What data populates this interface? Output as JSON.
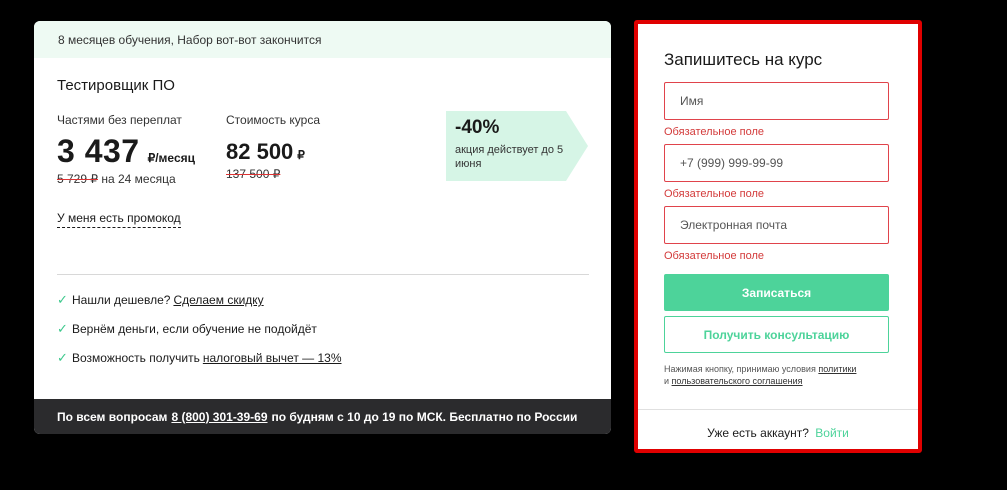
{
  "course": {
    "notice": "8 месяцев обучения, Набор вот-вот закончится",
    "title": "Тестировщик ПО",
    "installment": {
      "label": "Частями без переплат",
      "price": "3 437",
      "unit": "₽/месяц",
      "old_price": "5 729 ₽",
      "term": "на 24 месяца"
    },
    "full": {
      "label": "Стоимость курса",
      "price": "82 500",
      "unit": "₽",
      "old_price": "137 500 ₽"
    },
    "discount": {
      "percent": "-40%",
      "text": "акция действует до 5 июня"
    },
    "promo_link": "У меня есть промокод",
    "benefits": [
      {
        "text": "Нашли дешевле?",
        "link": "Сделаем скидку"
      },
      {
        "text": "Вернём деньги, если обучение не подойдёт",
        "link": ""
      },
      {
        "text": "Возможность получить",
        "link": "налоговый вычет — 13%"
      }
    ],
    "footer": {
      "prefix": "По всем вопросам",
      "phone": "8 (800) 301-39-69",
      "suffix": "по будням с 10 до 19 по МСК. Бесплатно по России"
    }
  },
  "form": {
    "title": "Запишитесь на курс",
    "fields": [
      {
        "placeholder": "Имя",
        "error": "Обязательное поле"
      },
      {
        "placeholder": "+7 (999) 999-99-99",
        "error": "Обязательное поле"
      },
      {
        "placeholder": "Электронная почта",
        "error": "Обязательное поле"
      }
    ],
    "submit_label": "Записаться",
    "consult_label": "Получить консультацию",
    "terms_prefix": "Нажимая кнопку, принимаю условия",
    "terms_policy": "политики",
    "terms_and": "и",
    "terms_agreement": "пользовательского соглашения",
    "account_text": "Уже есть аккаунт?",
    "login_label": "Войти"
  },
  "colors": {
    "accent": "#4dd39a",
    "error": "#d33a3a",
    "highlight_border": "#e00000",
    "notice_bg": "#eefaf3",
    "footer_bg": "#2b2b2d"
  }
}
